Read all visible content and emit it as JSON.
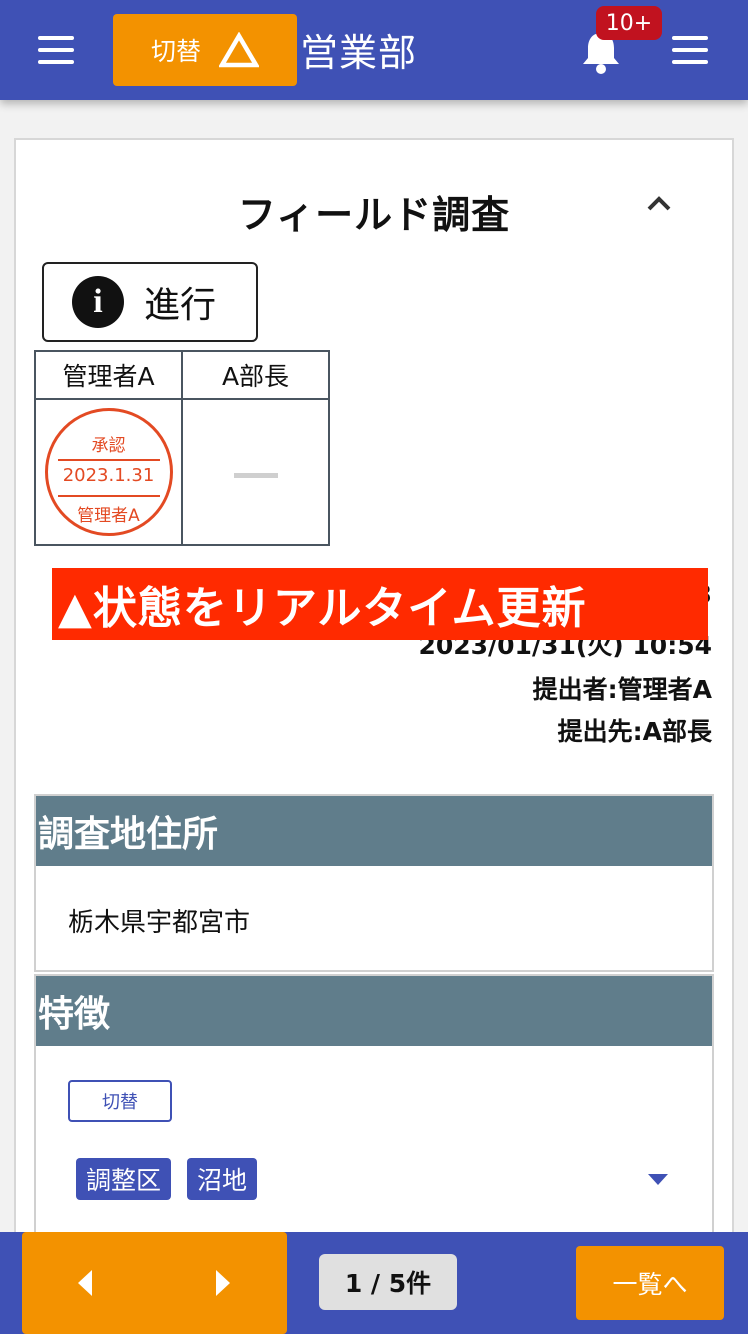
{
  "header": {
    "switch_label": "切替",
    "department": "営業部",
    "notification_badge": "10+"
  },
  "card": {
    "title": "フィールド調査",
    "status_label": "進行",
    "approval": {
      "headers": [
        "管理者A",
        "A部長"
      ],
      "stamp": {
        "top": "承認",
        "date": "2023.1.31",
        "bottom": "管理者A"
      },
      "pending_mark": "—"
    },
    "meta": {
      "id_partial": "3",
      "datetime": "2023/01/31(火) 10:54",
      "submitter": "提出者:管理者A",
      "recipient": "提出先:A部長"
    },
    "banner": "▲状態をリアルタイム更新",
    "sections": {
      "address": {
        "heading": "調査地住所",
        "value": "栃木県宇都宮市"
      },
      "features": {
        "heading": "特徴",
        "switch_label": "切替",
        "tags": [
          "調整区",
          "沼地"
        ]
      }
    }
  },
  "footer": {
    "count": "1 / 5件",
    "list_button": "一覧へ"
  },
  "colors": {
    "primary": "#3f51b5",
    "accent": "#f39200",
    "banner": "#ff2a00",
    "section_header": "#607d8b",
    "stamp": "#e34a23",
    "badge": "#c1121f"
  }
}
